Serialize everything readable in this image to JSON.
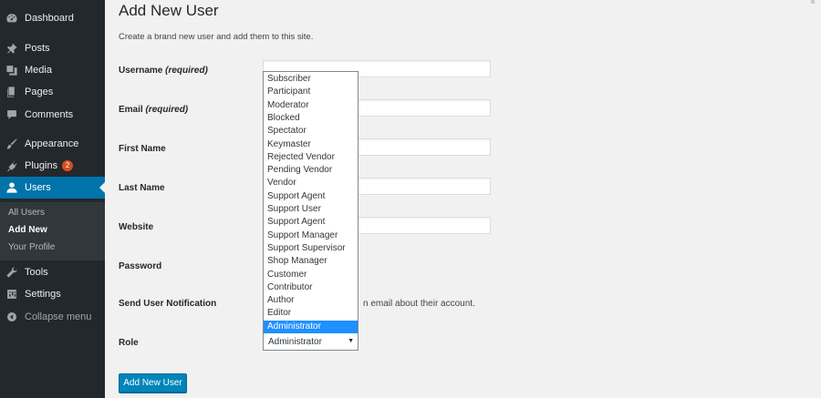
{
  "sidebar": {
    "items": [
      {
        "label": "Dashboard",
        "icon": "dashboard-icon"
      },
      {
        "label": "Posts",
        "icon": "pin-icon"
      },
      {
        "label": "Media",
        "icon": "media-icon"
      },
      {
        "label": "Pages",
        "icon": "pages-icon"
      },
      {
        "label": "Comments",
        "icon": "comment-icon"
      },
      {
        "label": "Appearance",
        "icon": "brush-icon"
      },
      {
        "label": "Plugins",
        "icon": "plugin-icon",
        "badge": "2"
      },
      {
        "label": "Users",
        "icon": "user-icon"
      },
      {
        "label": "Tools",
        "icon": "wrench-icon"
      },
      {
        "label": "Settings",
        "icon": "settings-icon"
      }
    ],
    "submenu": [
      "All Users",
      "Add New",
      "Your Profile"
    ],
    "collapse_label": "Collapse menu"
  },
  "page": {
    "title": "Add New User",
    "subtitle": "Create a brand new user and add them to this site."
  },
  "form": {
    "username_label": "Username",
    "username_required": "(required)",
    "email_label": "Email",
    "email_required": "(required)",
    "first_name_label": "First Name",
    "last_name_label": "Last Name",
    "website_label": "Website",
    "password_label": "Password",
    "notification_label": "Send User Notification",
    "notification_text": "n email about their account.",
    "role_label": "Role",
    "role_value": "Administrator",
    "submit_label": "Add New User"
  },
  "role_options": [
    "Subscriber",
    "Participant",
    "Moderator",
    "Blocked",
    "Spectator",
    "Keymaster",
    "Rejected Vendor",
    "Pending Vendor",
    "Vendor",
    "Support Agent",
    "Support User",
    "Support Agent",
    "Support Manager",
    "Support Supervisor",
    "Shop Manager",
    "Customer",
    "Contributor",
    "Author",
    "Editor",
    "Administrator"
  ],
  "colors": {
    "sidebar_bg": "#23282d",
    "accent": "#0073aa",
    "button": "#0085ba",
    "selected_option": "#1e90ff",
    "badge": "#d54e21"
  }
}
